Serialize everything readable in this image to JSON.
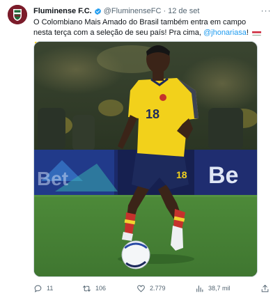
{
  "tweet": {
    "display_name": "Fluminense F.C.",
    "handle": "@FluminenseFC",
    "separator": "·",
    "date": "12 de set",
    "more_label": "···",
    "text_part1": "O Colombiano Mais Amado do Brasil também entra em campo nesta terça com a seleção de seu país! Pra cima, ",
    "mention": "@jhonariasa",
    "text_part2": "!",
    "flags": [
      "brazil-hungary-flag",
      "colombia-flag"
    ],
    "media": {
      "jersey_number": "18",
      "board_text_left": "Bet",
      "board_text_right": "Be"
    },
    "actions": {
      "replies": "11",
      "reposts": "106",
      "likes": "2.779",
      "views": "38,7 mil"
    },
    "colors": {
      "accent": "#1d9bf0",
      "text_secondary": "#536471",
      "jersey_yellow": "#f2d11b",
      "shorts_navy": "#1d2a5c",
      "pitch_green": "#4f8a3c"
    }
  }
}
